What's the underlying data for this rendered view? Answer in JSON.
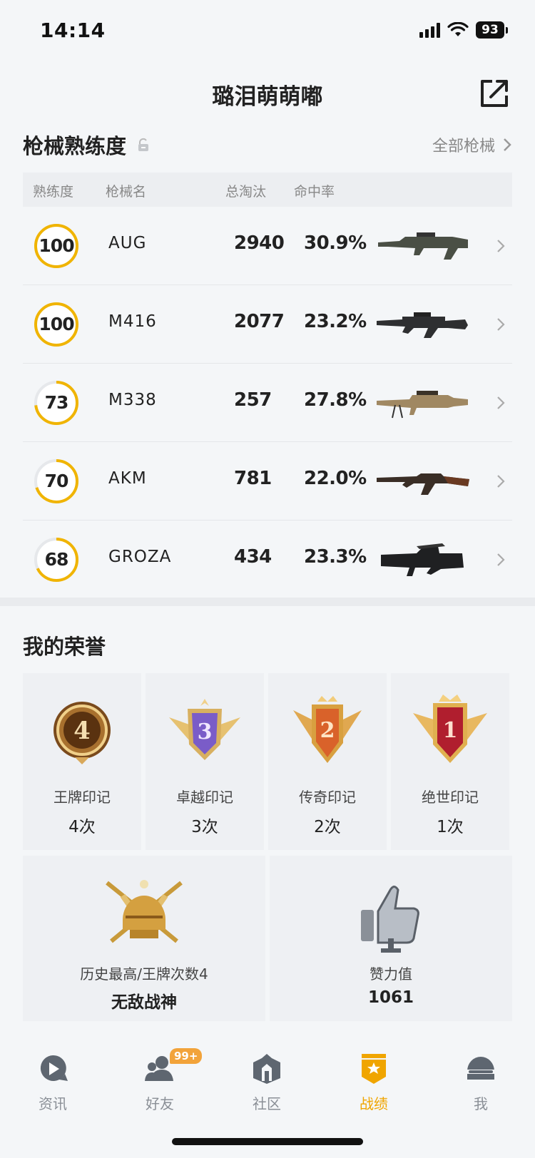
{
  "status_bar": {
    "time": "14:14",
    "battery": "93"
  },
  "header": {
    "title": "璐泪萌萌嘟"
  },
  "weapons": {
    "title": "枪械熟练度",
    "all_link": "全部枪械",
    "columns": {
      "proficiency": "熟练度",
      "name": "枪械名",
      "kills": "总淘汰",
      "accuracy": "命中率"
    },
    "rows": [
      {
        "proficiency": "100",
        "proficiency_fraction": 1.0,
        "name": "AUG",
        "kills": "2940",
        "accuracy": "30.9%",
        "gun_icon": "aug-rifle-icon"
      },
      {
        "proficiency": "100",
        "proficiency_fraction": 1.0,
        "name": "M416",
        "kills": "2077",
        "accuracy": "23.2%",
        "gun_icon": "m416-rifle-icon"
      },
      {
        "proficiency": "73",
        "proficiency_fraction": 0.73,
        "name": "M338",
        "kills": "257",
        "accuracy": "27.8%",
        "gun_icon": "m338-gun-icon"
      },
      {
        "proficiency": "70",
        "proficiency_fraction": 0.7,
        "name": "AKM",
        "kills": "781",
        "accuracy": "22.0%",
        "gun_icon": "akm-rifle-icon"
      },
      {
        "proficiency": "68",
        "proficiency_fraction": 0.68,
        "name": "GROZA",
        "kills": "434",
        "accuracy": "23.3%",
        "gun_icon": "groza-rifle-icon"
      }
    ]
  },
  "honors": {
    "title": "我的荣誉",
    "marks": [
      {
        "name": "王牌印记",
        "count": "4次",
        "badge_number": "4",
        "badge_color": "#b8863a"
      },
      {
        "name": "卓越印记",
        "count": "3次",
        "badge_number": "3",
        "badge_color": "#7a5cc8"
      },
      {
        "name": "传奇印记",
        "count": "2次",
        "badge_number": "2",
        "badge_color": "#d9622a"
      },
      {
        "name": "绝世印记",
        "count": "1次",
        "badge_number": "1",
        "badge_color": "#b01e2e"
      }
    ],
    "highest": {
      "label": "历史最高/王牌次数4",
      "value": "无敌战神"
    },
    "likes": {
      "label": "赞力值",
      "value": "1061"
    }
  },
  "tabs": [
    {
      "label": "资讯",
      "icon": "news-play-icon",
      "active": false
    },
    {
      "label": "好友",
      "icon": "friends-icon",
      "active": false,
      "badge": "99+"
    },
    {
      "label": "社区",
      "icon": "community-icon",
      "active": false
    },
    {
      "label": "战绩",
      "icon": "record-badge-icon",
      "active": true
    },
    {
      "label": "我",
      "icon": "helmet-icon",
      "active": false
    }
  ],
  "colors": {
    "accent": "#f0b400",
    "ring_track": "#e6e8eb",
    "tab_active": "#f0a500",
    "tab_inactive": "#8a8f96"
  }
}
